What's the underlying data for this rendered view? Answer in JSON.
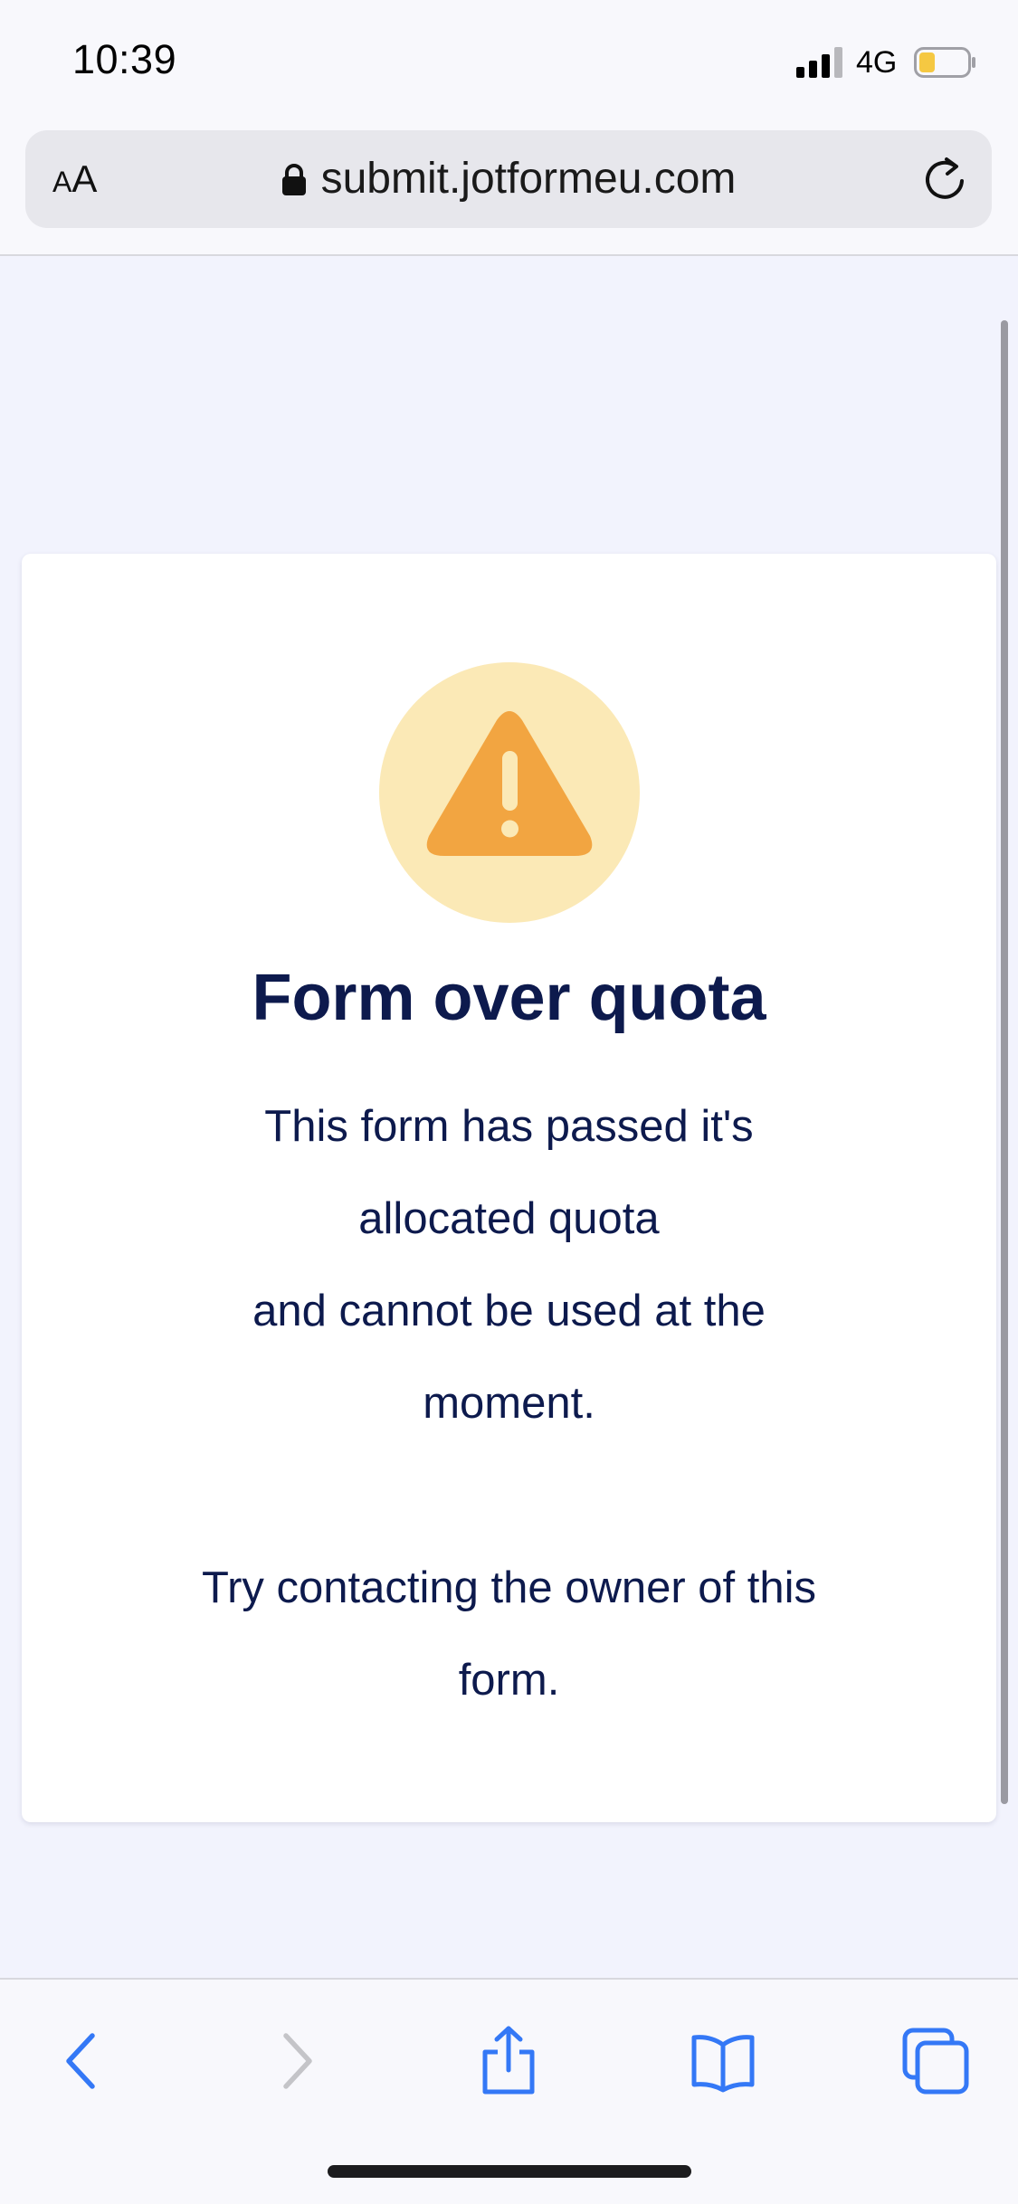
{
  "status_bar": {
    "time": "10:39",
    "network": "4G",
    "battery_color": "#f5c842"
  },
  "browser": {
    "text_size_button": {
      "small": "A",
      "large": "A"
    },
    "url": "submit.jotformeu.com"
  },
  "card": {
    "icon": "warning-triangle-icon",
    "icon_color": "#f2a541",
    "icon_bg_color": "#fbe9b6",
    "title": "Form over quota",
    "message_lines": [
      "This form has passed it's",
      "allocated quota",
      "and cannot be used at the",
      "moment."
    ],
    "contact_lines": [
      "Try contacting the owner of this",
      "form."
    ]
  },
  "toolbar": {
    "accent_color": "#3478f6",
    "items": [
      "back-icon",
      "forward-icon",
      "share-icon",
      "bookmarks-icon",
      "tabs-icon"
    ]
  }
}
